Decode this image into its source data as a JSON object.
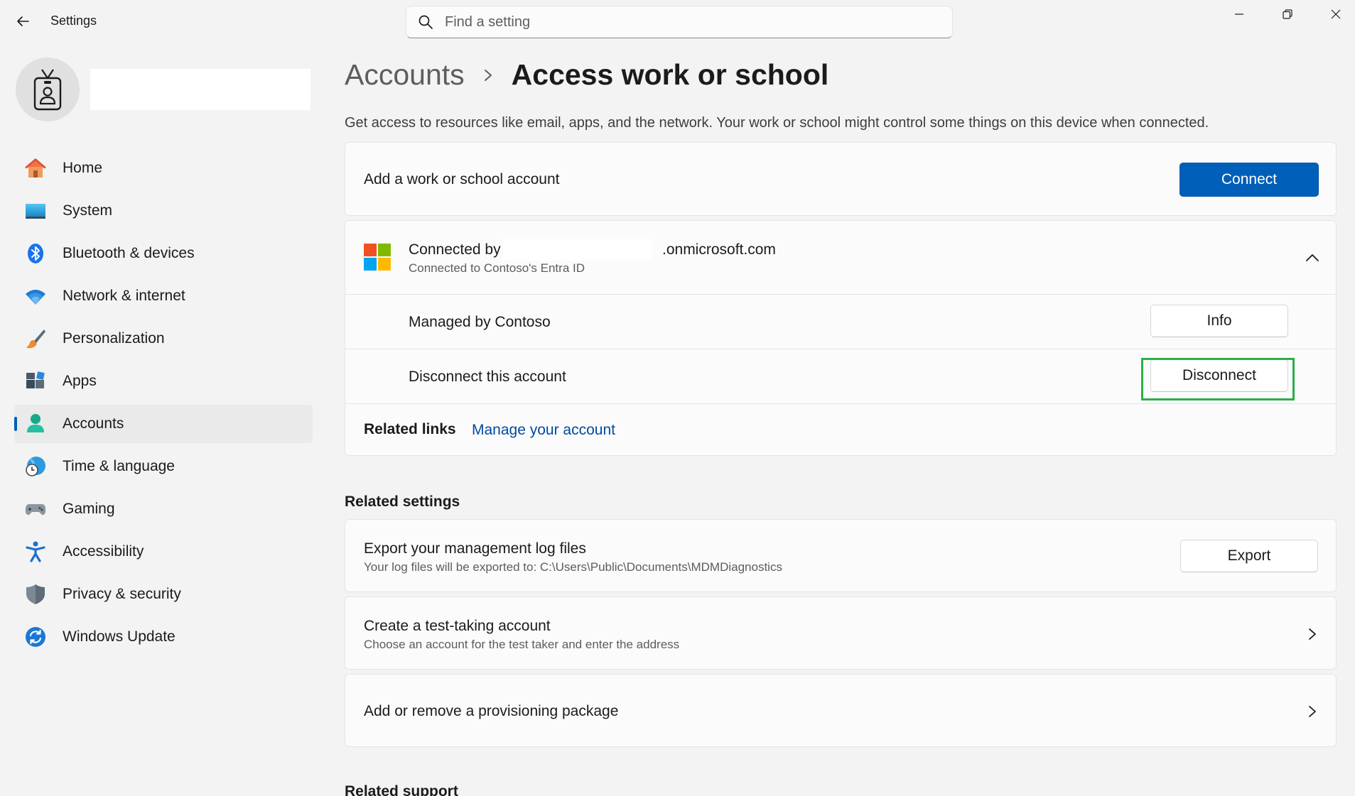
{
  "app": {
    "title": "Settings",
    "search_placeholder": "Find a setting"
  },
  "sidebar": {
    "items": [
      {
        "label": "Home",
        "icon": "home-icon"
      },
      {
        "label": "System",
        "icon": "system-icon"
      },
      {
        "label": "Bluetooth & devices",
        "icon": "bluetooth-icon"
      },
      {
        "label": "Network & internet",
        "icon": "wifi-icon"
      },
      {
        "label": "Personalization",
        "icon": "brush-icon"
      },
      {
        "label": "Apps",
        "icon": "apps-icon"
      },
      {
        "label": "Accounts",
        "icon": "accounts-icon",
        "active": true
      },
      {
        "label": "Time & language",
        "icon": "globe-clock-icon"
      },
      {
        "label": "Gaming",
        "icon": "gamepad-icon"
      },
      {
        "label": "Accessibility",
        "icon": "accessibility-icon"
      },
      {
        "label": "Privacy & security",
        "icon": "shield-icon"
      },
      {
        "label": "Windows Update",
        "icon": "update-icon"
      }
    ]
  },
  "header": {
    "breadcrumb_parent": "Accounts",
    "breadcrumb_current": "Access work or school",
    "description": "Get access to resources like email, apps, and the network. Your work or school might control some things on this device when connected."
  },
  "add_account": {
    "label": "Add a work or school account",
    "button": "Connect"
  },
  "connected": {
    "title_prefix": "Connected by",
    "title_suffix": ".onmicrosoft.com",
    "subtitle": "Connected to Contoso's Entra ID",
    "managed_label": "Managed by Contoso",
    "info_button": "Info",
    "disconnect_label": "Disconnect this account",
    "disconnect_button": "Disconnect",
    "related_links_label": "Related links",
    "manage_link": "Manage your account"
  },
  "related_settings": {
    "heading": "Related settings",
    "export": {
      "title": "Export your management log files",
      "subtitle": "Your log files will be exported to: C:\\Users\\Public\\Documents\\MDMDiagnostics",
      "button": "Export"
    },
    "test_taking": {
      "title": "Create a test-taking account",
      "subtitle": "Choose an account for the test taker and enter the address"
    },
    "provisioning": {
      "title": "Add or remove a provisioning package"
    }
  },
  "related_support": {
    "heading": "Related support"
  },
  "colors": {
    "accent": "#005fb8",
    "highlight": "#2bae4a",
    "link": "#004a9f"
  }
}
